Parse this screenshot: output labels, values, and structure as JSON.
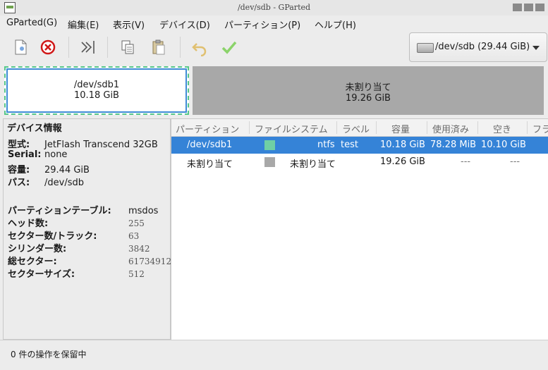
{
  "window": {
    "title": "/dev/sdb - GParted"
  },
  "menu": [
    "GParted(G)",
    "編集(E)",
    "表示(V)",
    "デバイス(D)",
    "パーティション(P)",
    "ヘルプ(H)"
  ],
  "device_selector": {
    "label": "/dev/sdb (29.44 GiB)"
  },
  "graph": {
    "sdb1": {
      "name": "/dev/sdb1",
      "size": "10.18 GiB"
    },
    "unalloc": {
      "name": "未割り当て",
      "size": "19.26 GiB"
    }
  },
  "device_info": {
    "heading": "デバイス情報",
    "model_label": "型式:",
    "model": "JetFlash Transcend 32GB",
    "serial_label": "Serial:",
    "serial": "none",
    "size_label": "容量:",
    "size": "29.44 GiB",
    "path_label": "パス:",
    "path": "/dev/sdb",
    "ptable_label": "パーティションテーブル:",
    "ptable": "msdos",
    "heads_label": "ヘッド数:",
    "heads": "255",
    "spt_label": "セクター数/トラック:",
    "spt": "63",
    "cyl_label": "シリンダー数:",
    "cyl": "3842",
    "total_label": "総セクター:",
    "total": "61734912",
    "ssize_label": "セクターサイズ:",
    "ssize": "512"
  },
  "columns": [
    "パーティション",
    "ファイルシステム",
    "ラベル",
    "容量",
    "使用済み",
    "空き",
    "フラ"
  ],
  "rows": [
    {
      "partition": "/dev/sdb1",
      "fs": "ntfs",
      "fs_color": "#6fcfa5",
      "label": "test",
      "size": "10.18 GiB",
      "used": "78.28 MiB",
      "free": "10.10 GiB"
    },
    {
      "partition": "未割り当て",
      "fs": "未割り当て",
      "fs_color": "#a8a8a8",
      "label": "",
      "size": "19.26 GiB",
      "used": "---",
      "free": "---"
    }
  ],
  "status": {
    "text": "0 件の操作を保留中"
  }
}
